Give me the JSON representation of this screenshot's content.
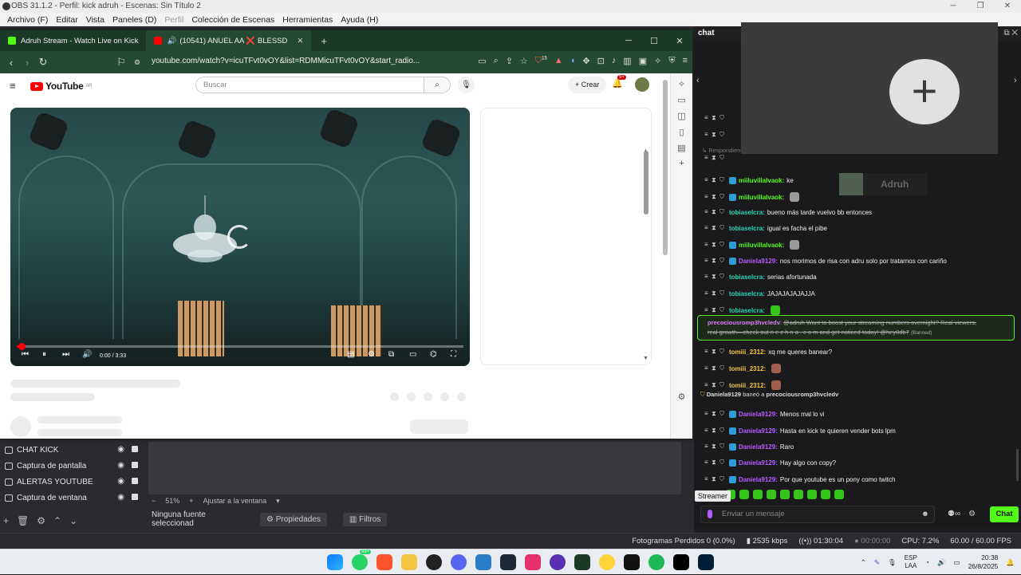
{
  "obs": {
    "title": "OBS 31.1.2 - Perfil: kick adruh - Escenas: Sin Título 2",
    "menu": [
      "Archivo (F)",
      "Editar",
      "Vista",
      "Paneles (D)",
      "Perfil",
      "Colección de Escenas",
      "Herramientas",
      "Ayuda (H)"
    ],
    "sources": [
      "CHAT KICK",
      "Captura de pantalla",
      "ALERTAS YOUTUBE",
      "Captura de ventana"
    ],
    "zoom": "51%",
    "fit_label": "Ajustar a la ventana",
    "no_source": "Ninguna fuente seleccionad",
    "properties_label": "Propiedades",
    "filters_label": "Filtros"
  },
  "status": {
    "dropped": "Fotogramas Perdidos 0 (0.0%)",
    "bitrate": "2535 kbps",
    "live_time": "01:30:04",
    "rec_time": "00:00:00",
    "cpu": "CPU: 7.2%",
    "fps": "60.00 / 60.00 FPS"
  },
  "browser": {
    "tabs": [
      {
        "label": "Adruh Stream - Watch Live on Kick",
        "color": "#53fc18"
      },
      {
        "label": "(10541) ANUEL AA ❌ BLESSD",
        "color": "#ff0000"
      }
    ],
    "url": "youtube.com/watch?v=icuTFvt0vOY&list=RDMMicuTFvt0vOY&start_radio...",
    "shield_badge": "15"
  },
  "youtube": {
    "logo_text": "YouTube",
    "region": "AR",
    "search_placeholder": "Buscar",
    "create_label": "Crear",
    "bell_badge": "9+",
    "time": "0:00 / 3:33",
    "progress": 0.01
  },
  "chat": {
    "title": "chat",
    "replying": "Respondiendo",
    "overlay_name": "Adruh",
    "messages": [
      {
        "user": "miiluvillalvaok",
        "text": "ke",
        "color": "#53fc18"
      },
      {
        "user": "miiluvillalvaok",
        "text": "",
        "color": "#53fc18",
        "emote": true
      },
      {
        "user": "tobiaselcra",
        "text": "bueno más tarde vuelvo bb entonces",
        "color": "#23d6b3"
      },
      {
        "user": "tobiaselcra",
        "text": "igual es facha el pibe",
        "color": "#23d6b3"
      },
      {
        "user": "miiluvillalvaok",
        "text": "",
        "color": "#53fc18",
        "emote": true
      },
      {
        "user": "Daniela9129",
        "text": "nos morimos de risa con adru solo por tratarnos con cariño",
        "color": "#b45cff"
      },
      {
        "user": "tobiaselcra",
        "text": "serias afortunada",
        "color": "#23d6b3"
      },
      {
        "user": "tobiaselcra",
        "text": "JAJAJAJAJAJJA",
        "color": "#23d6b3"
      },
      {
        "user": "tobiaselcra",
        "text": "",
        "color": "#23d6b3",
        "emote": true
      }
    ],
    "banned": {
      "user": "precociousromp3hvcledv",
      "line1": "@adruh Want to boost your streaming numbers overnight? Real viewers,",
      "line2": "real growth—check out n e z h n a . c o m and get noticed today! @hey0db7",
      "tag": "(Banned)"
    },
    "messages2": [
      {
        "user": "tomiii_2312",
        "text": "xq me queres banear?",
        "color": "#f5c542"
      },
      {
        "user": "tomiii_2312",
        "text": "",
        "color": "#f5c542",
        "emote": true
      },
      {
        "user": "tomiii_2312",
        "text": "",
        "color": "#f5c542",
        "emote": true
      }
    ],
    "ban_notice": {
      "moderator": "Daniela9129",
      "action": "baneó a",
      "target": "precociousromp3hvcledv"
    },
    "messages3": [
      {
        "user": "Daniela9129",
        "text": "Menos mal lo vi",
        "color": "#b45cff"
      },
      {
        "user": "Daniela9129",
        "text": "Hasta en kick te quieren vender bots lpm",
        "color": "#b45cff"
      },
      {
        "user": "Daniela9129",
        "text": "Raro",
        "color": "#b45cff"
      },
      {
        "user": "Daniela9129",
        "text": "Hay algo con copy?",
        "color": "#b45cff"
      },
      {
        "user": "Daniela9129",
        "text": "Por que youtube es un pony como twitch",
        "color": "#b45cff"
      }
    ],
    "streamer_tip": "Streamer",
    "input_placeholder": "Enviar un mensaje",
    "send_label": "Chat",
    "accent": "#53fc18"
  },
  "taskbar": {
    "whatsapp_badge": "99+",
    "lang": "ESP",
    "lang2": "LAA",
    "time": "20:38",
    "date": "26/8/2025"
  }
}
